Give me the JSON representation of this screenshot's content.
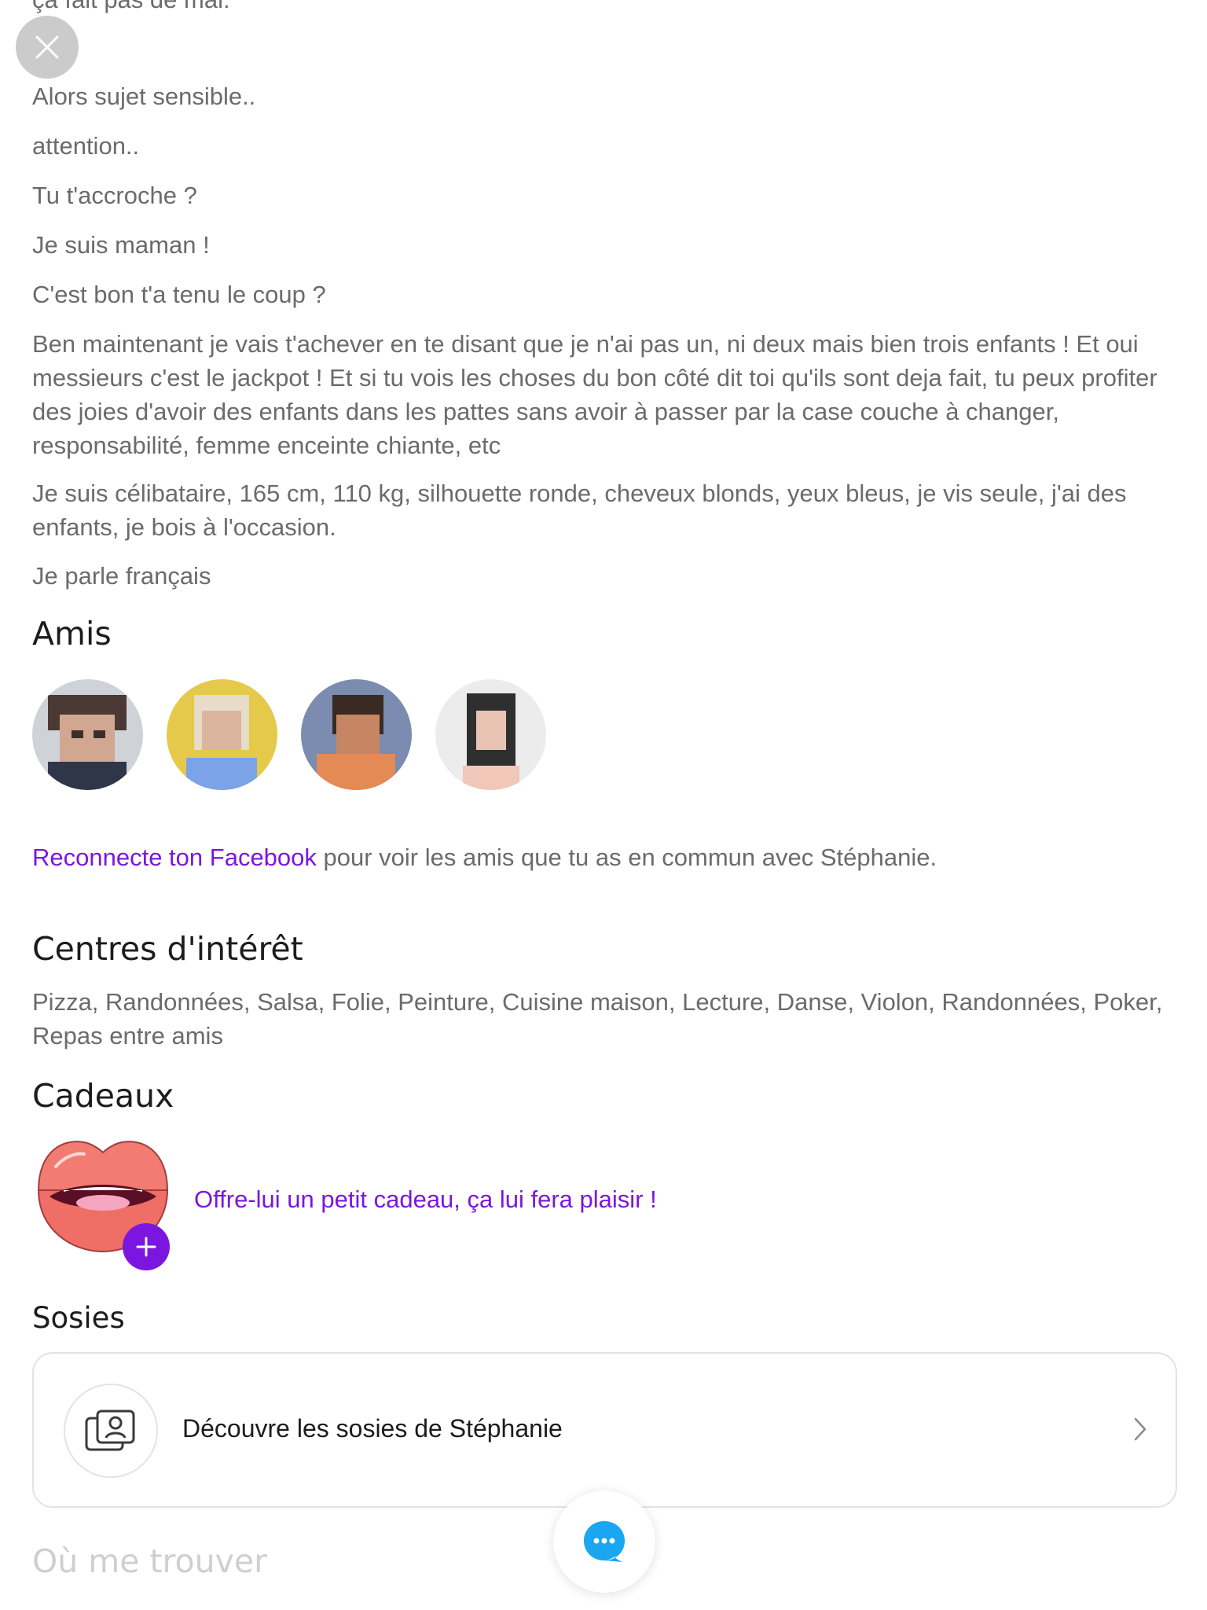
{
  "bio": {
    "cut_line": "ça fait pas de mal.",
    "lines": [
      "Alors sujet sensible..",
      "attention..",
      "Tu t'accroche ?",
      "Je suis maman !",
      "C'est bon t'a tenu le coup ?",
      "Ben maintenant je vais t'achever en te disant que je n'ai pas un, ni deux mais bien trois enfants ! Et oui messieurs c'est le jackpot ! Et si tu vois les choses du bon côté dit toi qu'ils sont deja fait, tu peux profiter des joies d'avoir des enfants dans les pattes sans avoir à passer par la case couche à changer, responsabilité, femme enceinte chiante, etc",
      "Je suis célibataire, 165 cm, 110 kg, silhouette ronde, cheveux blonds, yeux bleus, je vis seule, j'ai des enfants, je bois à l'occasion.",
      "Je parle français"
    ]
  },
  "friends": {
    "title": "Amis",
    "reconnect_link": "Reconnecte ton Facebook",
    "reconnect_text": " pour voir les amis que tu as en commun avec Stéphanie."
  },
  "interests": {
    "title": "Centres d'intérêt",
    "text": "Pizza, Randonnées, Salsa, Folie, Peinture, Cuisine maison, Lecture, Danse, Violon, Randonnées, Poker, Repas entre amis"
  },
  "gifts": {
    "title": "Cadeaux",
    "offer_text": "Offre-lui un petit cadeau, ça lui fera plaisir !"
  },
  "lookalikes": {
    "title": "Sosies",
    "card_label": "Découvre les sosies de Stéphanie"
  },
  "location": {
    "title": "Où me trouver"
  },
  "colors": {
    "accent": "#7b16e0",
    "chat_blue": "#1aa6f0",
    "text_gray": "#6b6b6b",
    "heading": "#1c1c1c"
  },
  "icons": {
    "close": "close-icon",
    "gift": "lips-icon",
    "plus": "plus-icon",
    "lookalike": "portrait-cards-icon",
    "chevron": "chevron-right-icon",
    "chat": "chat-bubble-icon"
  }
}
